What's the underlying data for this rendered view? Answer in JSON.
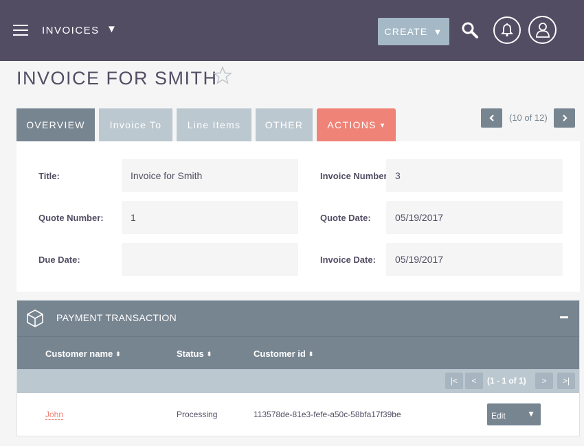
{
  "colors": {
    "topbar": "#534d64",
    "accent": "#f08377",
    "tab_active": "#778591",
    "tab_inactive": "#bcc8d0"
  },
  "header": {
    "menu_icon": "hamburger-icon",
    "module": "INVOICES",
    "module_caret": "▼",
    "create_label": "CREATE",
    "create_caret": "▼",
    "search_icon": "search-icon",
    "notifications_icon": "bell-icon",
    "profile_icon": "user-icon"
  },
  "page": {
    "title": "INVOICE FOR SMITH",
    "favorite_icon": "star-icon"
  },
  "tabs": [
    {
      "label": "OVERVIEW",
      "active": true
    },
    {
      "label": "Invoice To"
    },
    {
      "label": "Line Items"
    },
    {
      "label": "OTHER"
    },
    {
      "label": "ACTIONS",
      "caret": "▾"
    }
  ],
  "record_pager": {
    "position": "(10 of 12)",
    "prev_icon": "chevron-left-icon",
    "next_icon": "chevron-right-icon"
  },
  "fields": {
    "title": {
      "label": "Title:",
      "value": "Invoice for Smith"
    },
    "invoice_number": {
      "label": "Invoice Number:",
      "value": "3"
    },
    "quote_number": {
      "label": "Quote Number:",
      "value": "1"
    },
    "quote_date": {
      "label": "Quote Date:",
      "value": "05/19/2017"
    },
    "due_date": {
      "label": "Due Date:",
      "value": ""
    },
    "invoice_date": {
      "label": "Invoice Date:",
      "value": "05/19/2017"
    }
  },
  "subpanel": {
    "icon": "box-icon",
    "title": "PAYMENT TRANSACTION",
    "collapse_icon": "minus-icon",
    "columns": [
      "Customer name",
      "Status",
      "Customer id"
    ],
    "sort_icon": "⬍",
    "pagination": {
      "first": "|<",
      "prev": "<",
      "text": "(1 - 1 of 1)",
      "next": ">",
      "last": ">|"
    },
    "rows": [
      {
        "customer_name": "John",
        "status": "Processing",
        "customer_id": "113578de-81e3-fefe-a50c-58bfa17f39be",
        "action": "Edit",
        "action_caret": "▼"
      }
    ]
  }
}
